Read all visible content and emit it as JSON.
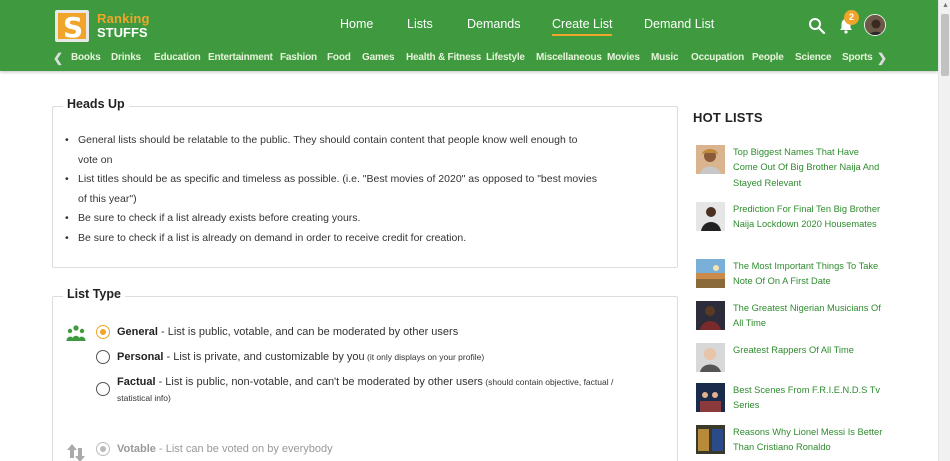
{
  "logo": {
    "ranking": "Ranking",
    "stuffs": "STUFFS",
    "mark": "S"
  },
  "nav": [
    {
      "label": "Home"
    },
    {
      "label": "Lists"
    },
    {
      "label": "Demands"
    },
    {
      "label": "Create List",
      "active": true
    },
    {
      "label": "Demand List"
    }
  ],
  "header": {
    "notification_count": "2"
  },
  "categories": [
    "Books",
    "Drinks",
    "Education",
    "Entertainment",
    "Fashion",
    "Food",
    "Games",
    "Health & Fitness",
    "Lifestyle",
    "Miscellaneous",
    "Movies",
    "Music",
    "Occupation",
    "People",
    "Science",
    "Sports"
  ],
  "heads_up": {
    "title": "Heads Up",
    "items": [
      "General lists should be relatable to the public. They should contain content that people know well enough to",
      "vote on",
      "List titles should be as specific and timeless as possible. (i.e. \"Best movies of 2020\" as opposed to \"best movies",
      "of this year\")",
      "Be sure to check if a list already exists before creating yours.",
      "Be sure to check if a list is already on demand in order to receive credit for creation."
    ]
  },
  "list_type": {
    "title": "List Type",
    "options": [
      {
        "name": "General",
        "desc": " - List is public, votable, and can be moderated by other users",
        "note": "",
        "checked": true
      },
      {
        "name": "Personal",
        "desc": " - List is private, and customizable by you",
        "note": " (it only displays on your profile)",
        "checked": false
      },
      {
        "name": "Factual",
        "desc": " - List is public, non-votable, and can't be moderated by other users",
        "note": " (should contain objective, factual /",
        "note2": "statistical info)",
        "checked": false
      }
    ],
    "votable": {
      "name": "Votable",
      "desc": " - List can be voted on by everybody"
    }
  },
  "hot_lists": {
    "title": "HOT LISTS",
    "items": [
      {
        "text": "Top Biggest Names That Have Come Out Of Big Brother Naija And Stayed Relevant",
        "thumb_color": "#c9a07a"
      },
      {
        "text": "Prediction For Final Ten Big Brother Naija Lockdown 2020 Housemates",
        "thumb_color": "#3a3a3a"
      },
      {
        "text": "The Most Important Things To Take Note Of On A First Date",
        "thumb_color": "#c98a4a"
      },
      {
        "text": "The Greatest Nigerian Musicians Of All Time",
        "thumb_color": "#2a2a3a"
      },
      {
        "text": "Greatest Rappers Of All Time",
        "thumb_color": "#cfcfcf"
      },
      {
        "text": "Best Scenes From F.R.I.E.N.D.S Tv Series",
        "thumb_color": "#1a2a4a"
      },
      {
        "text": "Reasons Why Lionel Messi Is Better Than Cristiano Ronaldo",
        "thumb_color": "#6a5a2a"
      }
    ]
  },
  "colors": {
    "brand_green": "#3f9a3f",
    "accent_orange": "#f0a52a",
    "link_green": "#2e8b2e"
  }
}
